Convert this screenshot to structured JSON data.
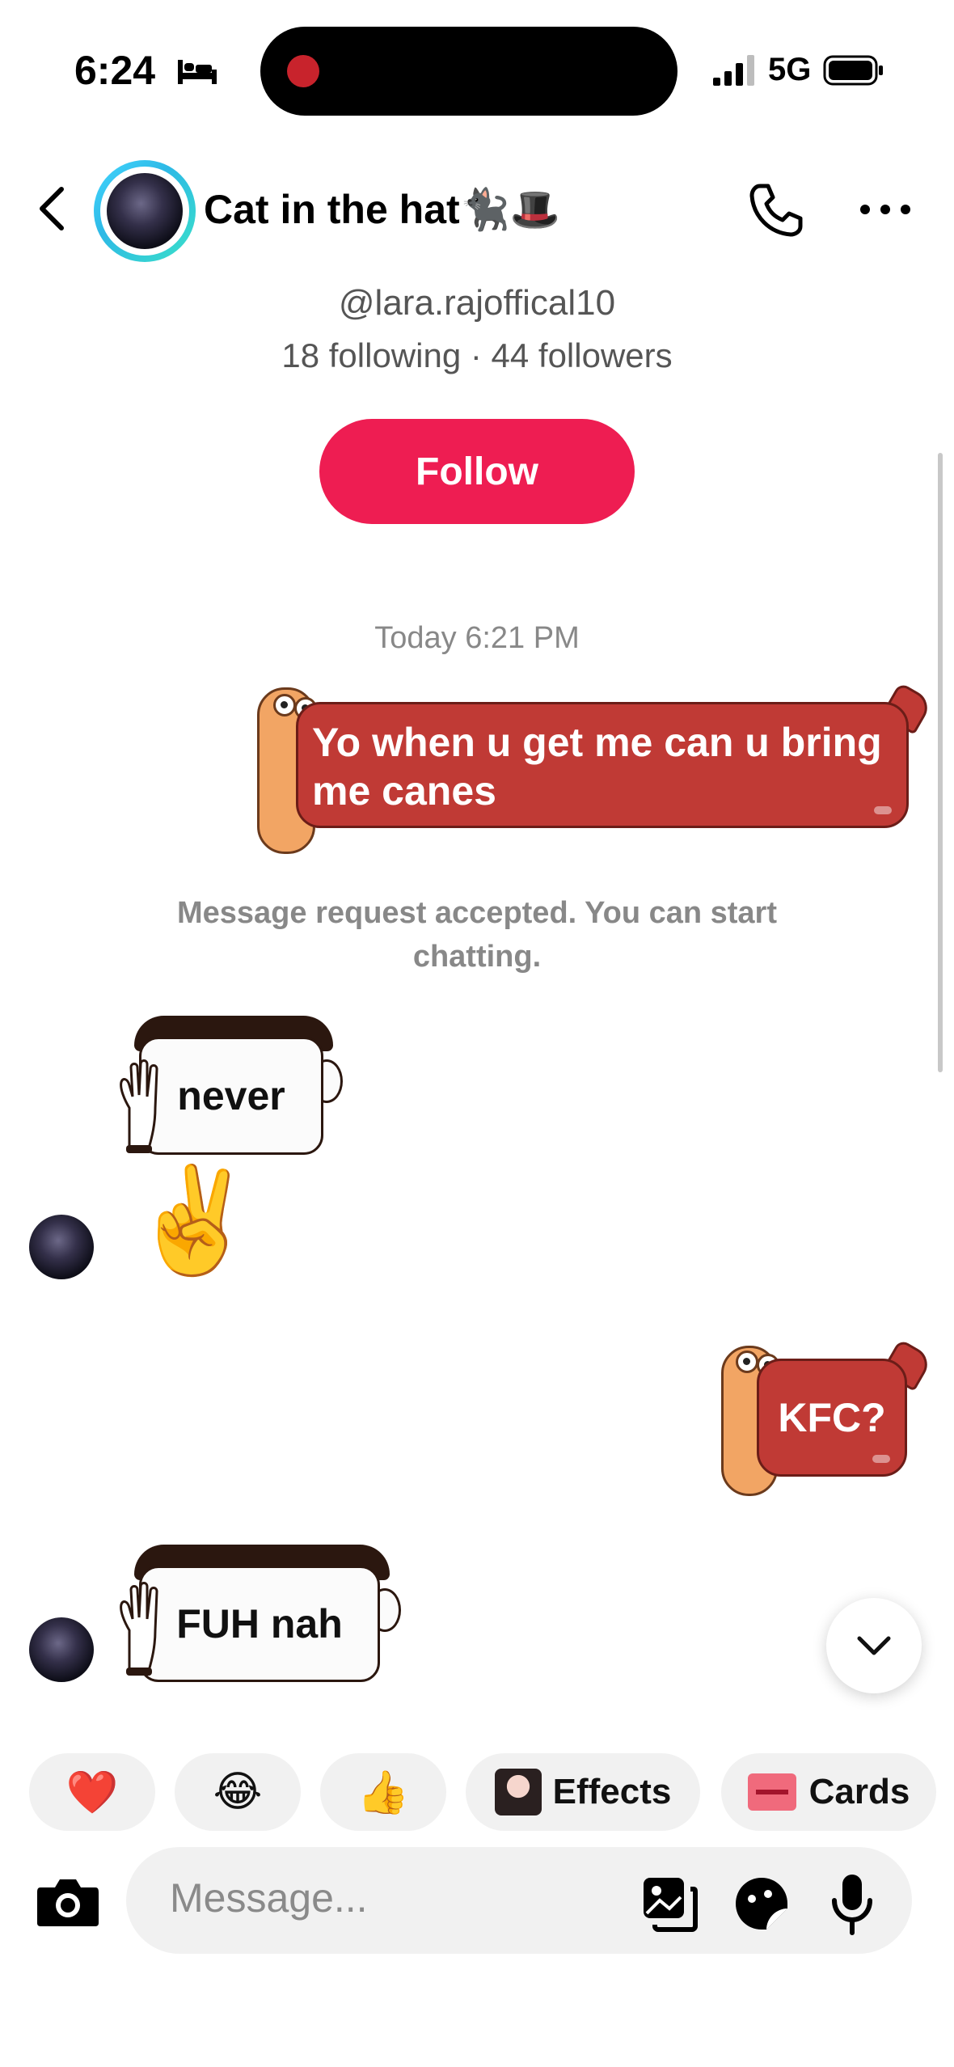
{
  "status_bar": {
    "time": "6:24",
    "network": "5G"
  },
  "header": {
    "title": "Cat in the hat🐈‍⬛🎩"
  },
  "profile": {
    "handle": "@lara.rajoffical10",
    "stats": "18 following · 44 followers",
    "follow_label": "Follow"
  },
  "chat": {
    "timestamp": "Today 6:21 PM",
    "messages": [
      {
        "from": "me",
        "text": "Yo when u get me can u bring me canes"
      },
      {
        "from": "system",
        "text": "Message request accepted. You can start chatting."
      },
      {
        "from": "them",
        "text": "never"
      },
      {
        "from": "them",
        "text": "✌️"
      },
      {
        "from": "me",
        "text": "KFC?"
      },
      {
        "from": "them",
        "text": "FUH nah"
      }
    ]
  },
  "quick_reactions": [
    {
      "emoji": "❤️"
    },
    {
      "emoji": "😂"
    },
    {
      "emoji": "👍"
    },
    {
      "label": "Effects"
    },
    {
      "label": "Cards"
    }
  ],
  "composer": {
    "placeholder": "Message..."
  },
  "colors": {
    "accent": "#ee1d52",
    "sent_bubble": "#c03a35",
    "ring": "#2db9e6"
  }
}
